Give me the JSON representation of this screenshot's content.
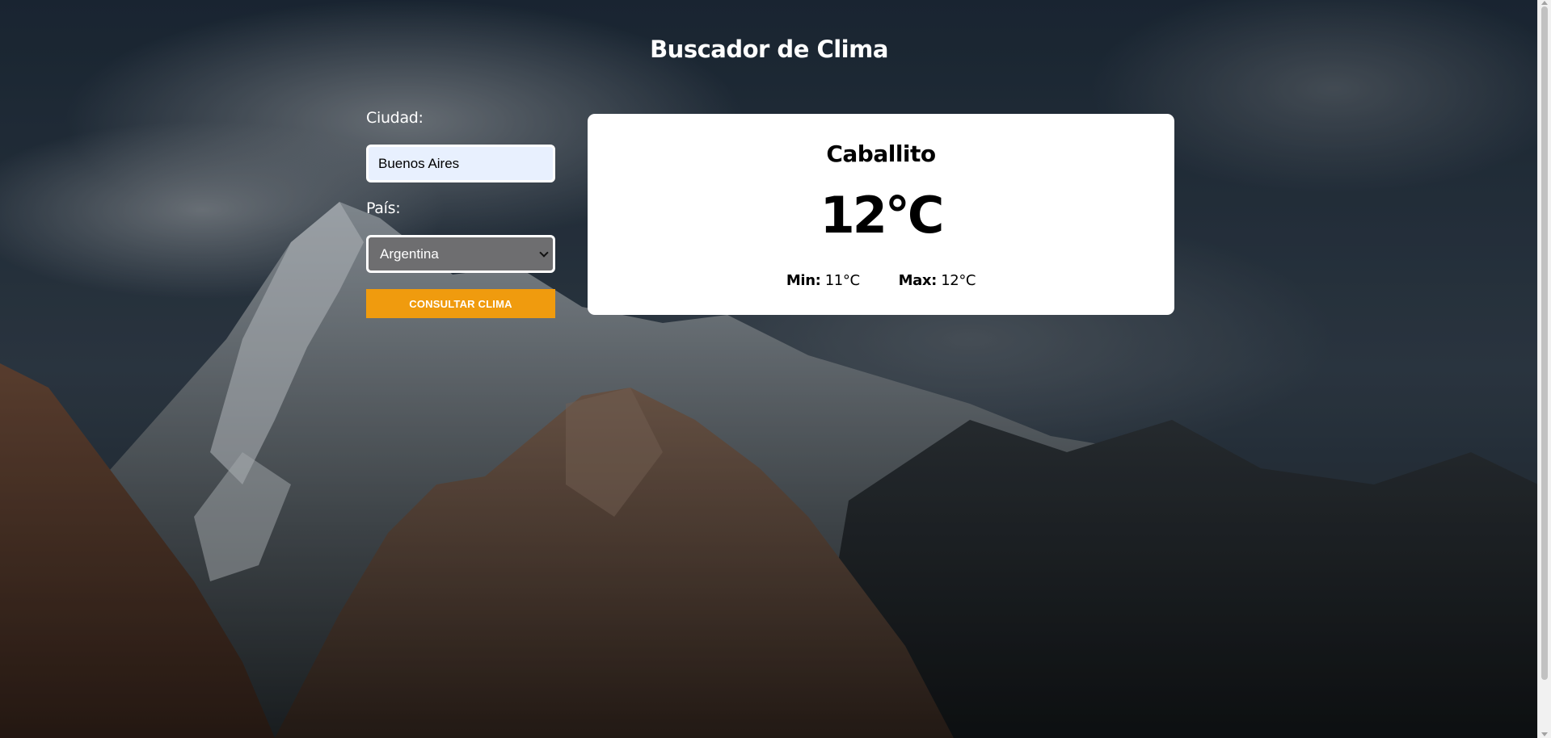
{
  "header": {
    "title": "Buscador de Clima"
  },
  "form": {
    "city_label": "Ciudad:",
    "city_value": "Buenos Aires",
    "country_label": "País:",
    "country_selected": "Argentina",
    "submit_label": "CONSULTAR CLIMA"
  },
  "result": {
    "city": "Caballito",
    "temperature": "12°C",
    "min_label": "Min:",
    "min_value": "11°C",
    "max_label": "Max:",
    "max_value": "12°C"
  },
  "colors": {
    "button": "#f09b0e",
    "card": "#ffffff",
    "input_background": "#e8f0fe",
    "select_background": "#6e6e70"
  },
  "icons": {
    "select_arrow": "chevron-down-icon"
  }
}
